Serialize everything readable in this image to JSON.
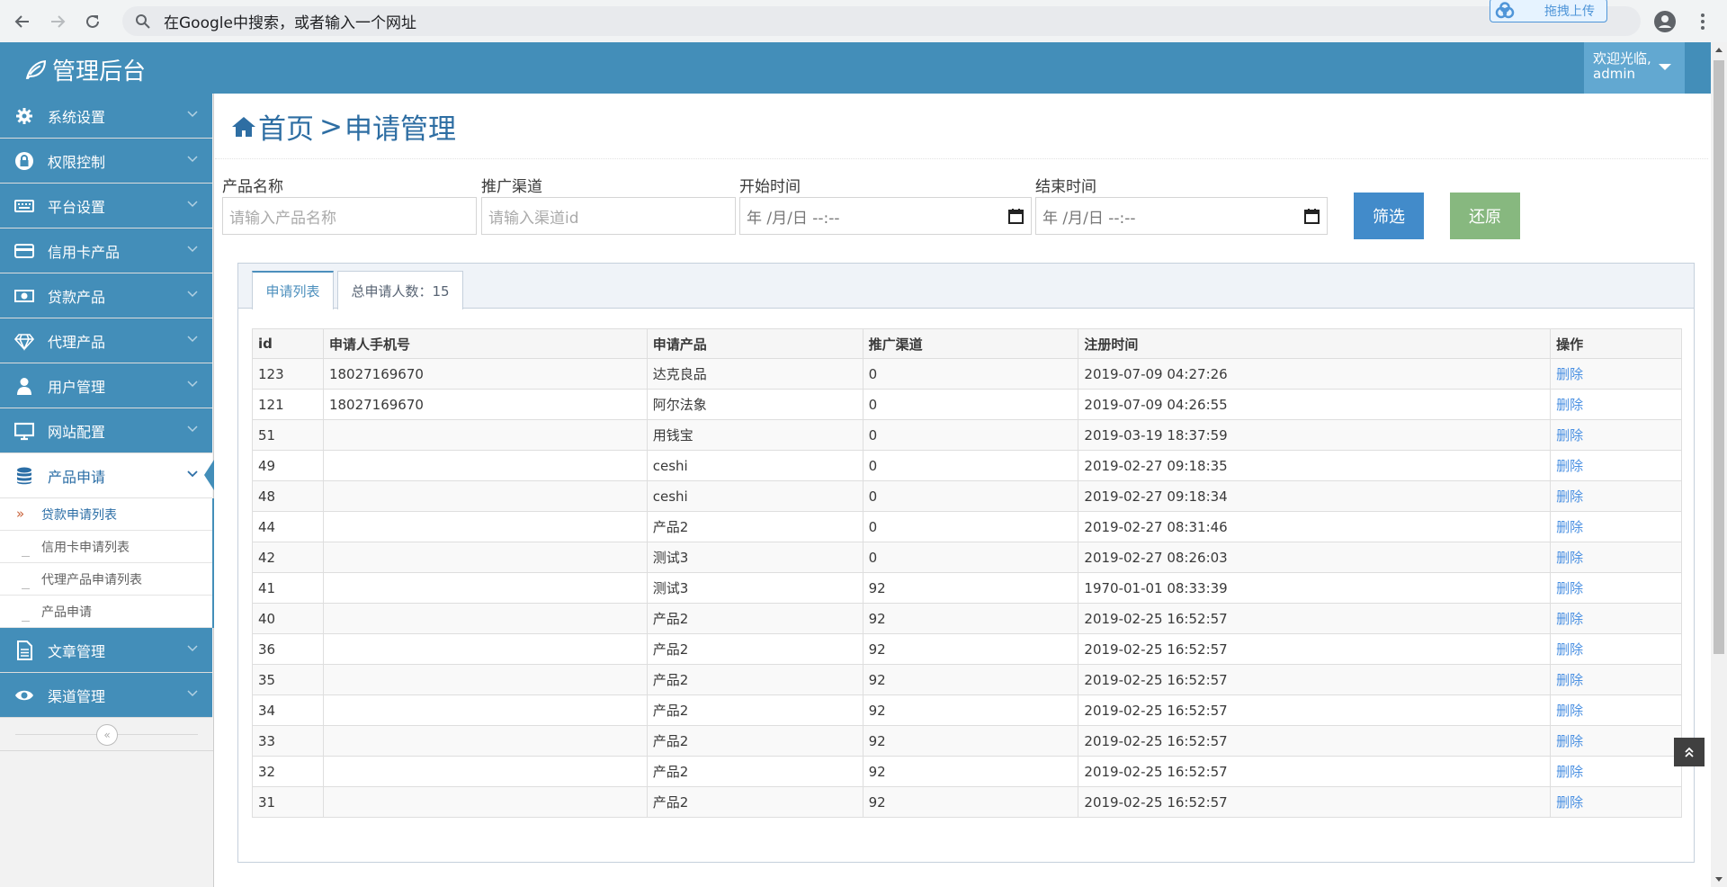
{
  "browser": {
    "omnibox_placeholder": "在Google中搜索，或者输入一个网址",
    "cloud_badge_label": "拖拽上传"
  },
  "header": {
    "brand": "管理后台",
    "welcome": "欢迎光临,",
    "username": "admin"
  },
  "sidebar": {
    "items": [
      {
        "label": "系统设置",
        "icon": "gear-icon"
      },
      {
        "label": "权限控制",
        "icon": "lock-icon"
      },
      {
        "label": "平台设置",
        "icon": "keyboard-icon"
      },
      {
        "label": "信用卡产品",
        "icon": "credit-card-icon"
      },
      {
        "label": "贷款产品",
        "icon": "money-icon"
      },
      {
        "label": "代理产品",
        "icon": "diamond-icon"
      },
      {
        "label": "用户管理",
        "icon": "user-icon"
      },
      {
        "label": "网站配置",
        "icon": "desktop-icon"
      },
      {
        "label": "产品申请",
        "icon": "database-icon"
      },
      {
        "label": "文章管理",
        "icon": "file-icon"
      },
      {
        "label": "渠道管理",
        "icon": "eye-icon"
      }
    ],
    "submenu": [
      "贷款申请列表",
      "信用卡申请列表",
      "代理产品申请列表",
      "产品申请"
    ]
  },
  "breadcrumb": {
    "home": "首页",
    "separator": ">",
    "current": "申请管理"
  },
  "filters": {
    "product_name_label": "产品名称",
    "product_name_placeholder": "请输入产品名称",
    "channel_label": "推广渠道",
    "channel_placeholder": "请输入渠道id",
    "start_label": "开始时间",
    "end_label": "结束时间",
    "date_placeholder": "年 /月/日 --:--",
    "filter_button": "筛选",
    "reset_button": "还原"
  },
  "tabs": {
    "list": "申请列表",
    "total": "总申请人数：15"
  },
  "table": {
    "headers": [
      "id",
      "申请人手机号",
      "申请产品",
      "推广渠道",
      "注册时间",
      "操作"
    ],
    "delete_label": "删除",
    "rows": [
      [
        "123",
        "18027169670",
        "达克良品",
        "0",
        "2019-07-09 04:27:26"
      ],
      [
        "121",
        "18027169670",
        "阿尔法象",
        "0",
        "2019-07-09 04:26:55"
      ],
      [
        "51",
        "",
        "用钱宝",
        "0",
        "2019-03-19 18:37:59"
      ],
      [
        "49",
        "",
        "ceshi",
        "0",
        "2019-02-27 09:18:35"
      ],
      [
        "48",
        "",
        "ceshi",
        "0",
        "2019-02-27 09:18:34"
      ],
      [
        "44",
        "",
        "产品2",
        "0",
        "2019-02-27 08:31:46"
      ],
      [
        "42",
        "",
        "测试3",
        "0",
        "2019-02-27 08:26:03"
      ],
      [
        "41",
        "",
        "测试3",
        "92",
        "1970-01-01 08:33:39"
      ],
      [
        "40",
        "",
        "产品2",
        "92",
        "2019-02-25 16:52:57"
      ],
      [
        "36",
        "",
        "产品2",
        "92",
        "2019-02-25 16:52:57"
      ],
      [
        "35",
        "",
        "产品2",
        "92",
        "2019-02-25 16:52:57"
      ],
      [
        "34",
        "",
        "产品2",
        "92",
        "2019-02-25 16:52:57"
      ],
      [
        "33",
        "",
        "产品2",
        "92",
        "2019-02-25 16:52:57"
      ],
      [
        "32",
        "",
        "产品2",
        "92",
        "2019-02-25 16:52:57"
      ],
      [
        "31",
        "",
        "产品2",
        "92",
        "2019-02-25 16:52:57"
      ]
    ]
  },
  "colors": {
    "header": "#438eb9",
    "filter_button": "#428bca",
    "reset_button": "#87b87f",
    "link": "#4a90e2"
  }
}
